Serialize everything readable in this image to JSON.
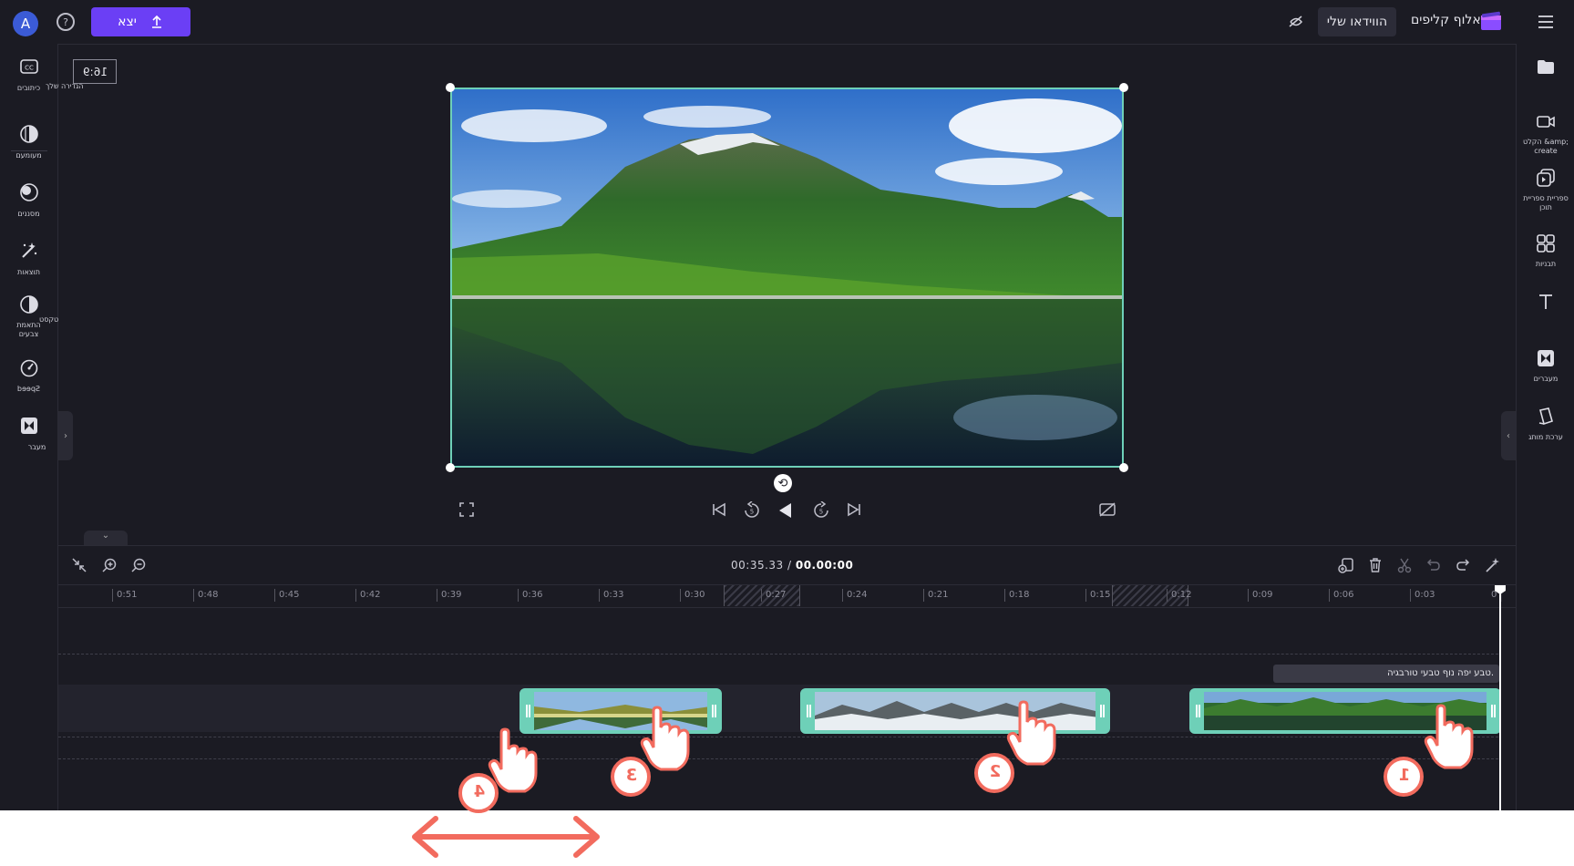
{
  "topbar": {
    "avatar_letter": "A",
    "help_glyph": "?",
    "export_label": "יצא",
    "my_videos_label": "הווידאו שלי",
    "brand_name": "אלוף קליפים"
  },
  "left_panel": {
    "items": [
      {
        "icon": "captions-icon",
        "label": "כיתובים"
      },
      {
        "icon": "fade-icon",
        "label": "מעומעם"
      },
      {
        "icon": "filters-icon",
        "label": "מסננים"
      },
      {
        "icon": "effects-icon",
        "label": "תוצאות"
      },
      {
        "icon": "color-adjust-icon",
        "label": "התאמת צבעים"
      },
      {
        "icon": "speed-icon",
        "label": "Speed"
      },
      {
        "icon": "transition-icon",
        "label": "מעבר"
      }
    ],
    "text_label": "טקסט"
  },
  "right_panel": {
    "items": [
      {
        "icon": "media-folder-icon",
        "label": ""
      },
      {
        "icon": "record-create-icon",
        "label": "הקלט &amp; create"
      },
      {
        "icon": "content-library-icon",
        "label": "ספריית ספריית תוכן"
      },
      {
        "icon": "templates-icon",
        "label": "תבניות"
      },
      {
        "icon": "text-icon",
        "label": ""
      },
      {
        "icon": "transitions-icon",
        "label": "מעברים"
      },
      {
        "icon": "brand-kit-icon",
        "label": "ערכת מותג"
      }
    ]
  },
  "preview": {
    "aspect_ratio": "16:9",
    "aspect_label": "הגדירה שלך"
  },
  "timeline": {
    "current_time": "00.00:00",
    "total_time": "00:35.33",
    "ticks": [
      "0",
      "0:03",
      "0:06",
      "0:09",
      "0:12",
      "0:15",
      "0:18",
      "0:21",
      "0:24",
      "0:27",
      "0:30",
      "0:33",
      "0:36",
      "0:39",
      "0:42",
      "0:45",
      "0:48",
      "0:51"
    ],
    "text_clip": "טבע יפה נוף טבעי טורבגיה.",
    "clips": [
      {
        "name": "lake-clip-1",
        "marker": "1"
      },
      {
        "name": "snow-clip-2",
        "marker": "2"
      },
      {
        "name": "valley-clip-3",
        "marker": "3"
      },
      {
        "name": "valley-clip-4",
        "marker": "4"
      }
    ]
  },
  "colors": {
    "accent": "#6b3ff5",
    "selection": "#6ed0b8",
    "annotation": "#f26b5e",
    "background": "#1b1b23"
  }
}
